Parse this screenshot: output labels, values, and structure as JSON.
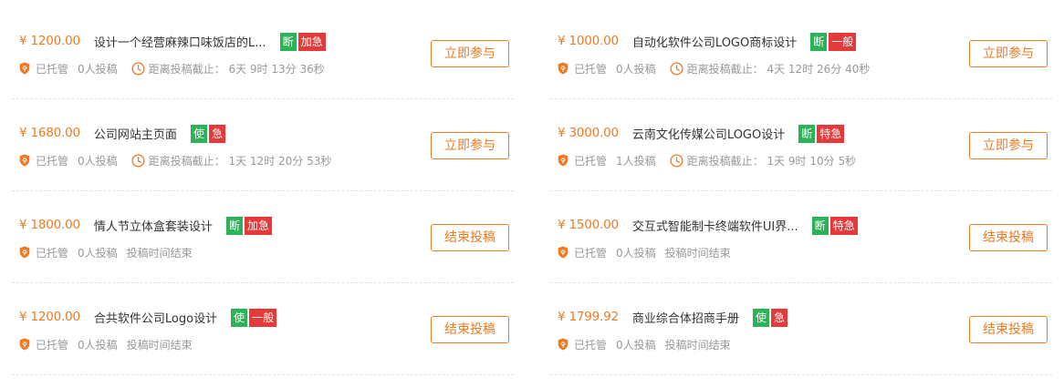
{
  "colors": {
    "accent": "#f07a22",
    "tag_green": "#2db357",
    "tag_red": "#e63a3a"
  },
  "icons": {
    "status": "shield-icon",
    "deadline": "clock-icon"
  },
  "left": [
    {
      "price": "¥ 1200.00",
      "title": "设计一个经营麻辣口味饭店的L...",
      "tags": [
        {
          "text": "断",
          "color": "green"
        },
        {
          "text": "加急",
          "color": "red"
        }
      ],
      "status": "已托管",
      "bids": "0人投稿",
      "deadline": "距离投稿截止：  6天 9时 13分 36秒",
      "has_clock": true,
      "button": "立即参与"
    },
    {
      "price": "¥ 1680.00",
      "title": "公司网站主页面",
      "tags": [
        {
          "text": "使",
          "color": "green"
        },
        {
          "text": "急",
          "color": "red"
        }
      ],
      "status": "已托管",
      "bids": "0人投稿",
      "deadline": "距离投稿截止：  1天 12时 20分 53秒",
      "has_clock": true,
      "button": "立即参与"
    },
    {
      "price": "¥ 1800.00",
      "title": "情人节立体盒套装设计",
      "tags": [
        {
          "text": "断",
          "color": "green"
        },
        {
          "text": "加急",
          "color": "red"
        }
      ],
      "status": "已托管",
      "bids": "0人投稿",
      "deadline": "投稿时间结束",
      "has_clock": false,
      "button": "结束投稿"
    },
    {
      "price": "¥ 1200.00",
      "title": "合共软件公司Logo设计",
      "tags": [
        {
          "text": "使",
          "color": "green"
        },
        {
          "text": "一般",
          "color": "red"
        }
      ],
      "status": "已托管",
      "bids": "0人投稿",
      "deadline": "投稿时间结束",
      "has_clock": false,
      "button": "结束投稿"
    }
  ],
  "right": [
    {
      "price": "¥ 1000.00",
      "title": "自动化软件公司LOGO商标设计",
      "tags": [
        {
          "text": "断",
          "color": "green"
        },
        {
          "text": "一般",
          "color": "red"
        }
      ],
      "status": "已托管",
      "bids": "0人投稿",
      "deadline": "距离投稿截止：  4天 12时 26分 40秒",
      "has_clock": true,
      "button": "立即参与"
    },
    {
      "price": "¥ 3000.00",
      "title": "云南文化传媒公司LOGO设计",
      "tags": [
        {
          "text": "断",
          "color": "green"
        },
        {
          "text": "特急",
          "color": "red"
        }
      ],
      "status": "已托管",
      "bids": "1人投稿",
      "deadline": "距离投稿截止：  1天 9时 10分 5秒",
      "has_clock": true,
      "button": "立即参与"
    },
    {
      "price": "¥ 1500.00",
      "title": "交互式智能制卡终端软件UI界...",
      "tags": [
        {
          "text": "断",
          "color": "green"
        },
        {
          "text": "特急",
          "color": "red"
        }
      ],
      "status": "已托管",
      "bids": "0人投稿",
      "deadline": "投稿时间结束",
      "has_clock": false,
      "button": "结束投稿"
    },
    {
      "price": "¥ 1799.92",
      "title": "商业综合体招商手册",
      "tags": [
        {
          "text": "使",
          "color": "green"
        },
        {
          "text": "急",
          "color": "red"
        }
      ],
      "status": "已托管",
      "bids": "0人投稿",
      "deadline": "投稿时间结束",
      "has_clock": false,
      "button": "结束投稿"
    }
  ]
}
